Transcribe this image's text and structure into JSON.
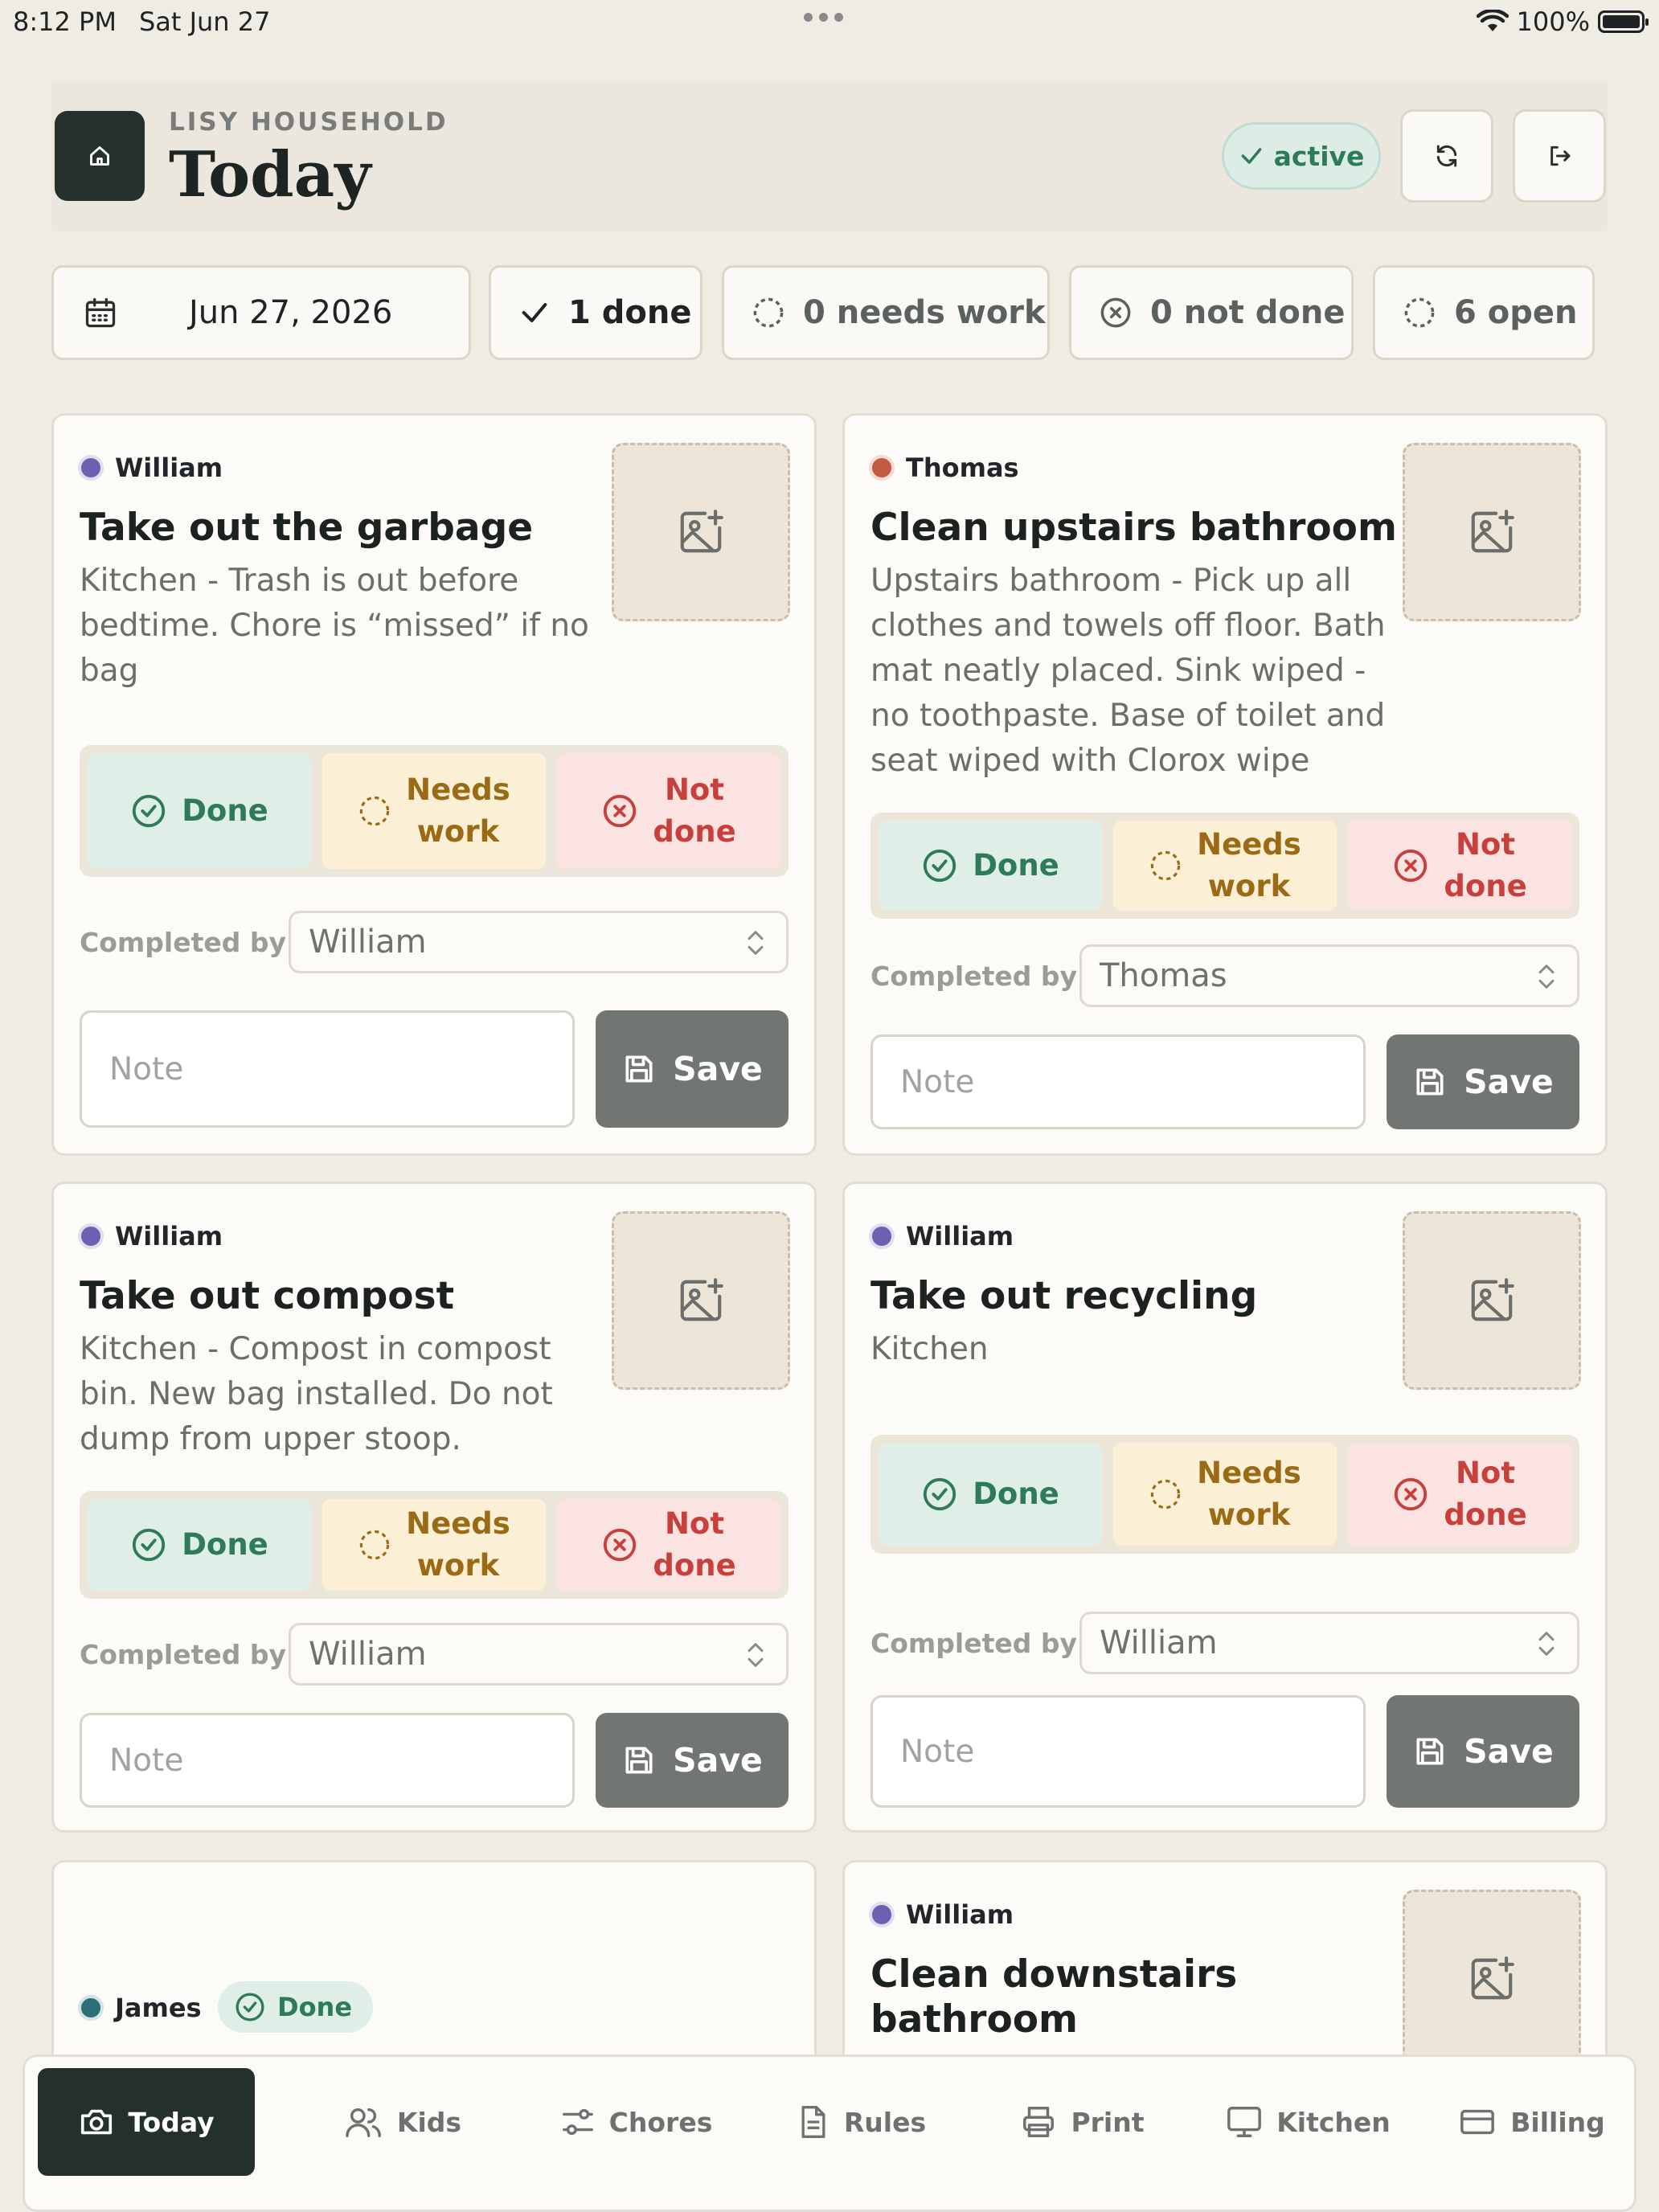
{
  "status_bar": {
    "time": "8:12 PM",
    "date": "Sat Jun 27",
    "battery": "100%"
  },
  "header": {
    "household": "LISY HOUSEHOLD",
    "title": "Today",
    "status": "active"
  },
  "stats": {
    "date": "Jun 27, 2026",
    "done": "1 done",
    "needs_work": "0 needs work",
    "not_done": "0 not done",
    "open": "6 open"
  },
  "labels": {
    "done": "Done",
    "needs_work_1": "Needs",
    "needs_work_2": "work",
    "not_done_1": "Not",
    "not_done_2": "done",
    "completed_by": "Completed by",
    "note_placeholder": "Note",
    "save": "Save"
  },
  "chores": [
    {
      "owner": "William",
      "title": "Take out the garbage",
      "desc": [
        "Kitchen - Trash is out before",
        "bedtime. Chore is “missed” if no",
        "bag"
      ],
      "completed_by": "William"
    },
    {
      "owner": "Thomas",
      "title": "Clean upstairs bathroom",
      "desc": [
        "Upstairs bathroom - Pick up all",
        "clothes and towels off floor. Bath",
        "mat neatly placed. Sink wiped -",
        "no toothpaste. Base of toilet and",
        "seat wiped with Clorox wipe"
      ],
      "completed_by": "Thomas"
    },
    {
      "owner": "William",
      "title": "Take out compost",
      "desc": [
        "Kitchen - Compost in compost",
        "bin. New bag installed. Do not",
        "dump from upper stoop."
      ],
      "completed_by": "William"
    },
    {
      "owner": "William",
      "title": "Take out recycling",
      "desc": [
        "Kitchen"
      ],
      "completed_by": "William"
    },
    {
      "owner": "James",
      "status_badge": "Done"
    },
    {
      "owner": "William",
      "title_lines": [
        "Clean downstairs",
        "bathroom"
      ]
    }
  ],
  "tabs": [
    "Today",
    "Kids",
    "Chores",
    "Rules",
    "Print",
    "Kitchen",
    "Billing"
  ],
  "colors": {
    "accent_dark": "#24302c",
    "done_green": "#2e7b5c",
    "needs_amber": "#9a6a14",
    "not_done_red": "#c8403c",
    "save_gray": "#727673"
  }
}
